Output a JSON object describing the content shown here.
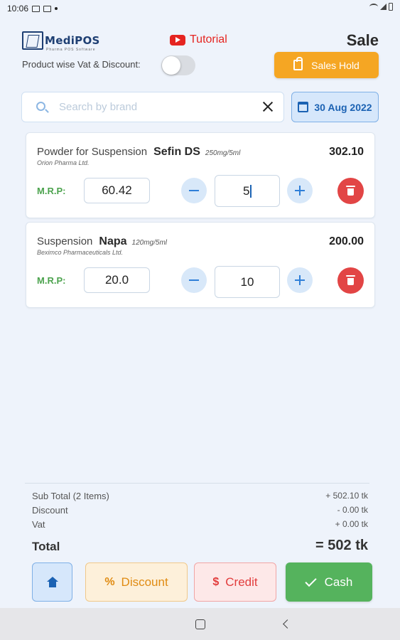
{
  "status_bar": {
    "time": "10:06"
  },
  "header": {
    "logo_text": "MediPOS",
    "logo_subtext": "Pharma POS Software",
    "tutorial_label": "Tutorial",
    "page_title": "Sale",
    "vat_toggle_label": "Product wise Vat & Discount:",
    "vat_toggle_on": false,
    "sales_hold_label": "Sales Hold"
  },
  "search": {
    "placeholder": "Search by brand",
    "value": ""
  },
  "date_label": "30 Aug 2022",
  "mrp_label": "M.R.P:",
  "cart": [
    {
      "type": "Powder for Suspension",
      "name": "Sefin DS",
      "strength": "250mg/5ml",
      "company": "Orion Pharma Ltd.",
      "price": "302.10",
      "mrp": "60.42",
      "qty": "5"
    },
    {
      "type": "Suspension",
      "name": "Napa",
      "strength": "120mg/5ml",
      "company": "Beximco Pharmaceuticals Ltd.",
      "price": "200.00",
      "mrp": "20.0",
      "qty": "10"
    }
  ],
  "summary": {
    "subtotal_label": "Sub Total (2 Items)",
    "subtotal_value": "+ 502.10 tk",
    "discount_label": "Discount",
    "discount_value": "- 0.00 tk",
    "vat_label": "Vat",
    "vat_value": "+ 0.00 tk",
    "total_label": "Total",
    "total_value": "= 502 tk"
  },
  "actions": {
    "discount_label": "Discount",
    "credit_label": "Credit",
    "cash_label": "Cash"
  },
  "colors": {
    "accent_blue": "#1b62b3",
    "sales_hold_orange": "#f5a623",
    "delete_red": "#e24545",
    "cash_green": "#55b35d",
    "mrp_green": "#4ca34e"
  }
}
